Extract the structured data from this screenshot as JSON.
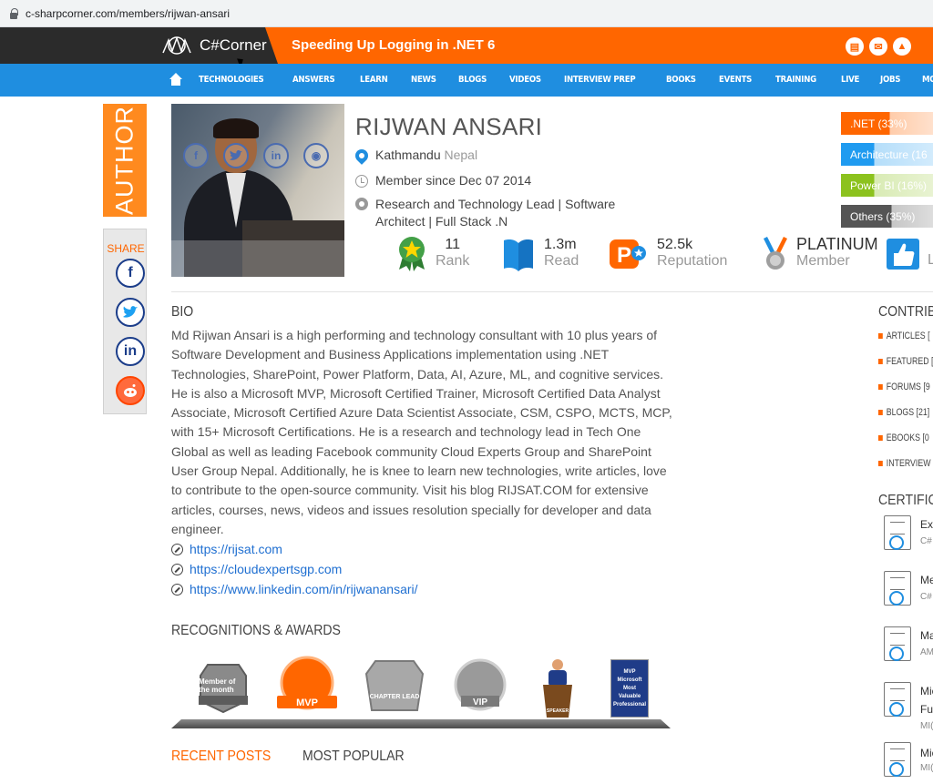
{
  "browser": {
    "url": "c-sharpcorner.com/members/rijwan-ansari"
  },
  "header": {
    "logo_text": "C#Corner",
    "headline": "Speeding Up Logging in .NET 6",
    "icons": [
      "chat-icon",
      "mail-icon",
      "bell-icon"
    ]
  },
  "nav": {
    "items": [
      "TECHNOLOGIES",
      "ANSWERS",
      "LEARN",
      "NEWS",
      "BLOGS",
      "VIDEOS",
      "INTERVIEW PREP",
      "BOOKS",
      "EVENTS",
      "TRAINING",
      "LIVE",
      "JOBS",
      "MORE ▾"
    ]
  },
  "sidebar": {
    "author_label": "AUTHOR",
    "share_label": "SHARE",
    "share_icons": [
      "facebook-icon",
      "twitter-icon",
      "linkedin-icon",
      "reddit-icon"
    ]
  },
  "profile": {
    "name": "RIJWAN ANSARI",
    "location_city": "Kathmandu",
    "location_country": "Nepal",
    "member_since": "Member since Dec 07 2014",
    "title_line1": "Research and Technology Lead | Software",
    "title_line2": "Architect | Full Stack .N",
    "stats": [
      {
        "value": "11",
        "label": "Rank",
        "icon": "rank-star-icon"
      },
      {
        "value": "1.3m",
        "label": "Read",
        "icon": "book-icon"
      },
      {
        "value": "52.5k",
        "label": "Reputation",
        "icon": "reputation-p-icon"
      },
      {
        "value": "PLATINUM",
        "label": "Member",
        "icon": "platinum-medal-icon"
      },
      {
        "value": "",
        "label": "Li",
        "icon": "thumbs-up-icon"
      }
    ]
  },
  "tech_bars": [
    {
      "label": ".NET (33%)",
      "percent": 33,
      "color": "#ff6600"
    },
    {
      "label": "Architecture (16",
      "percent": 16,
      "color": "#1f9bf0"
    },
    {
      "label": "Power BI (16%)",
      "percent": 16,
      "color": "#8cc21e"
    },
    {
      "label": "Others (35%)",
      "percent": 35,
      "color": "#555555"
    }
  ],
  "bio": {
    "heading": "BIO",
    "text": "Md Rijwan Ansari is a high performing and technology consultant with 10 plus years of Software Development and Business Applications implementation using .NET Technologies, SharePoint, Power Platform, Data, AI, Azure, ML, and cognitive services. He is also a Microsoft MVP, Microsoft Certified Trainer, Microsoft Certified Data Analyst Associate, Microsoft Certified Azure Data Scientist Associate, CSM, CSPO, MCTS, MCP, with 15+ Microsoft Certifications. He is a research and technology lead in Tech One Global as well as leading Facebook community Cloud Experts Group and SharePoint User Group Nepal. Additionally, he is knee to learn new technologies, write articles, love to contribute to the open-source community. Visit his blog RIJSAT.COM for extensive articles, courses, news, videos and issues resolution specially for developer and data engineer.",
    "links": [
      "https://rijsat.com",
      "https://cloudexpertsgp.com",
      "https://www.linkedin.com/in/rijwanansari/"
    ]
  },
  "awards": {
    "heading": "RECOGNITIONS & AWARDS",
    "badges": [
      "Member of the month",
      "MVP",
      "CHAPTER LEAD",
      "VIP",
      "SPEAKER",
      "MVP Microsoft Most Valuable Professional"
    ]
  },
  "posts_tabs": [
    "RECENT POSTS",
    "MOST POPULAR"
  ],
  "contributions": {
    "heading": "CONTRIBU",
    "items": [
      "ARTICLES [",
      "FEATURED [",
      "FORUMS [9",
      "BLOGS [21]",
      "EBOOKS [0",
      "INTERVIEW"
    ]
  },
  "certifications": {
    "heading": "CERTIFICA",
    "items": [
      {
        "title": "Exp",
        "sub": "C#"
      },
      {
        "title": "Me",
        "sub": "C#"
      },
      {
        "title": "Ma",
        "sub": "AM"
      },
      {
        "title": "Mic",
        "sub": "Fur"
      },
      {
        "title": "Mic",
        "sub": "MI("
      }
    ],
    "extra_sub": "MI("
  }
}
